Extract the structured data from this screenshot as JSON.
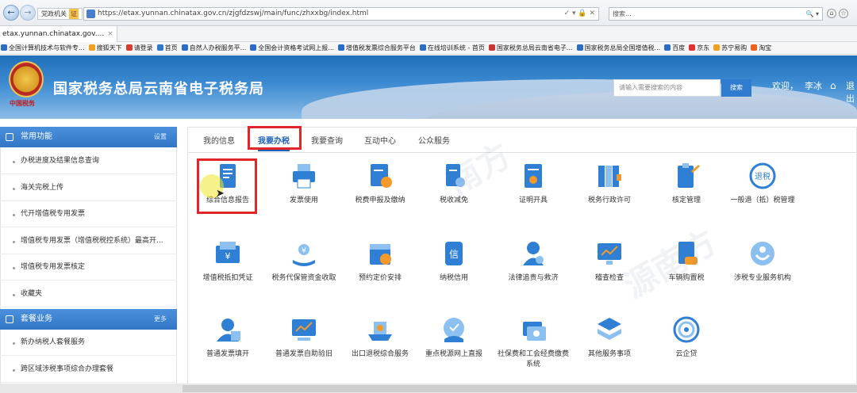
{
  "browser": {
    "mode_label": "党政机关",
    "mode_badge": "证",
    "url": "https://etax.yunnan.chinatax.gov.cn/zjgfdzswj/main/func/zhxxbg/index.html",
    "url_tail": "✓ ▾ 🔒 ✕",
    "search_placeholder": "搜索...",
    "search_tail": "🔍 ▾",
    "tab_title": "etax.yunnan.chinatax.gov....",
    "tab_close": "×",
    "favorites": [
      {
        "label": "全国计算机技术与软件专...",
        "color": "#2b6cc4"
      },
      {
        "label": "搜狐天下",
        "color": "#f0a020"
      },
      {
        "label": "请登录",
        "color": "#d83b2f"
      },
      {
        "label": "首页",
        "color": "#3377cc"
      },
      {
        "label": "自然人办税服务平...",
        "color": "#2b6cc4"
      },
      {
        "label": "全国会计资格考试网上报...",
        "color": "#2b6cc4"
      },
      {
        "label": "增值税发票综合服务平台",
        "color": "#2b6cc4"
      },
      {
        "label": "在线培训系统 - 首页",
        "color": "#2b6cc4"
      },
      {
        "label": "国家税务总局云南省电子...",
        "color": "#c33"
      },
      {
        "label": "国家税务总局全国增值税...",
        "color": "#2b6cc4"
      },
      {
        "label": "百度",
        "color": "#2b6cc4"
      },
      {
        "label": "京东",
        "color": "#d33"
      },
      {
        "label": "苏宁易购",
        "color": "#f0a020"
      },
      {
        "label": "淘宝",
        "color": "#f06020"
      }
    ]
  },
  "header": {
    "emblem_sub": "中国税务",
    "title": "国家税务总局云南省电子税务局",
    "search_placeholder": "请输入需要搜索的内容",
    "search_button": "搜索",
    "welcome": "欢迎，",
    "user": "李冰",
    "home_icon": "⌂",
    "logout": "退出"
  },
  "sidebar": {
    "common": {
      "title": "常用功能",
      "action": "设置",
      "items": [
        "办税进度及结果信息查询",
        "海关完税上传",
        "代开增值税专用发票",
        "增值税专用发票（增值税税控系统）最高开...",
        "增值税专用发票核定",
        "收藏夹"
      ]
    },
    "packages": {
      "title": "套餐业务",
      "action": "更多",
      "items": [
        "新办纳税人套餐服务",
        "跨区域涉税事项综合办理套餐"
      ]
    }
  },
  "main": {
    "tabs": [
      "我的信息",
      "我要办税",
      "我要查询",
      "互动中心",
      "公众服务"
    ],
    "active_tab": 1,
    "tiles": [
      {
        "label": "综合信息报告",
        "icon": "report-icon",
        "color": "#2f80d5"
      },
      {
        "label": "发票使用",
        "icon": "printer-icon",
        "color": "#2f80d5"
      },
      {
        "label": "税费申报及缴纳",
        "icon": "tax-declare-icon",
        "color": "#2f80d5"
      },
      {
        "label": "税收减免",
        "icon": "tax-relief-icon",
        "color": "#2f80d5"
      },
      {
        "label": "证明开具",
        "icon": "certificate-icon",
        "color": "#2f80d5"
      },
      {
        "label": "税务行政许可",
        "icon": "binders-icon",
        "color": "#2f80d5"
      },
      {
        "label": "核定管理",
        "icon": "clipboard-icon",
        "color": "#2f80d5"
      },
      {
        "label": "一般退（抵）税管理",
        "icon": "refund-icon",
        "color": "#2f80d5"
      },
      {
        "label": "增值税抵扣凭证",
        "icon": "deduction-icon",
        "color": "#2f80d5"
      },
      {
        "label": "税务代保管资金收取",
        "icon": "custody-icon",
        "color": "#2f80d5"
      },
      {
        "label": "预约定价安排",
        "icon": "calendar-icon",
        "color": "#2f80d5"
      },
      {
        "label": "纳税信用",
        "icon": "credit-icon",
        "color": "#2f80d5"
      },
      {
        "label": "法律追责与救济",
        "icon": "law-icon",
        "color": "#2f80d5"
      },
      {
        "label": "稽查检查",
        "icon": "monitor-chart-icon",
        "color": "#2f80d5"
      },
      {
        "label": "车辆购置税",
        "icon": "vehicle-tax-icon",
        "color": "#2f80d5"
      },
      {
        "label": "涉税专业服务机构",
        "icon": "service-agency-icon",
        "color": "#2f80d5"
      },
      {
        "label": "普通发票填开",
        "icon": "invoice-issue-icon",
        "color": "#2f80d5"
      },
      {
        "label": "普通发票自助验旧",
        "icon": "invoice-check-icon",
        "color": "#2f80d5"
      },
      {
        "label": "出口退税综合服务",
        "icon": "export-refund-icon",
        "color": "#2f80d5"
      },
      {
        "label": "重点税源网上直报",
        "icon": "tax-source-icon",
        "color": "#2f80d5"
      },
      {
        "label": "社保费和工会经费缴费系统",
        "icon": "social-security-icon",
        "color": "#2f80d5"
      },
      {
        "label": "其他服务事项",
        "icon": "other-services-icon",
        "color": "#2f80d5"
      },
      {
        "label": "云企贷",
        "icon": "cloud-loan-icon",
        "color": "#2f80d5"
      }
    ]
  },
  "colors": {
    "accent": "#2f80d5",
    "highlight": "#e0262b",
    "sidebar_header": "#3f86d6"
  }
}
